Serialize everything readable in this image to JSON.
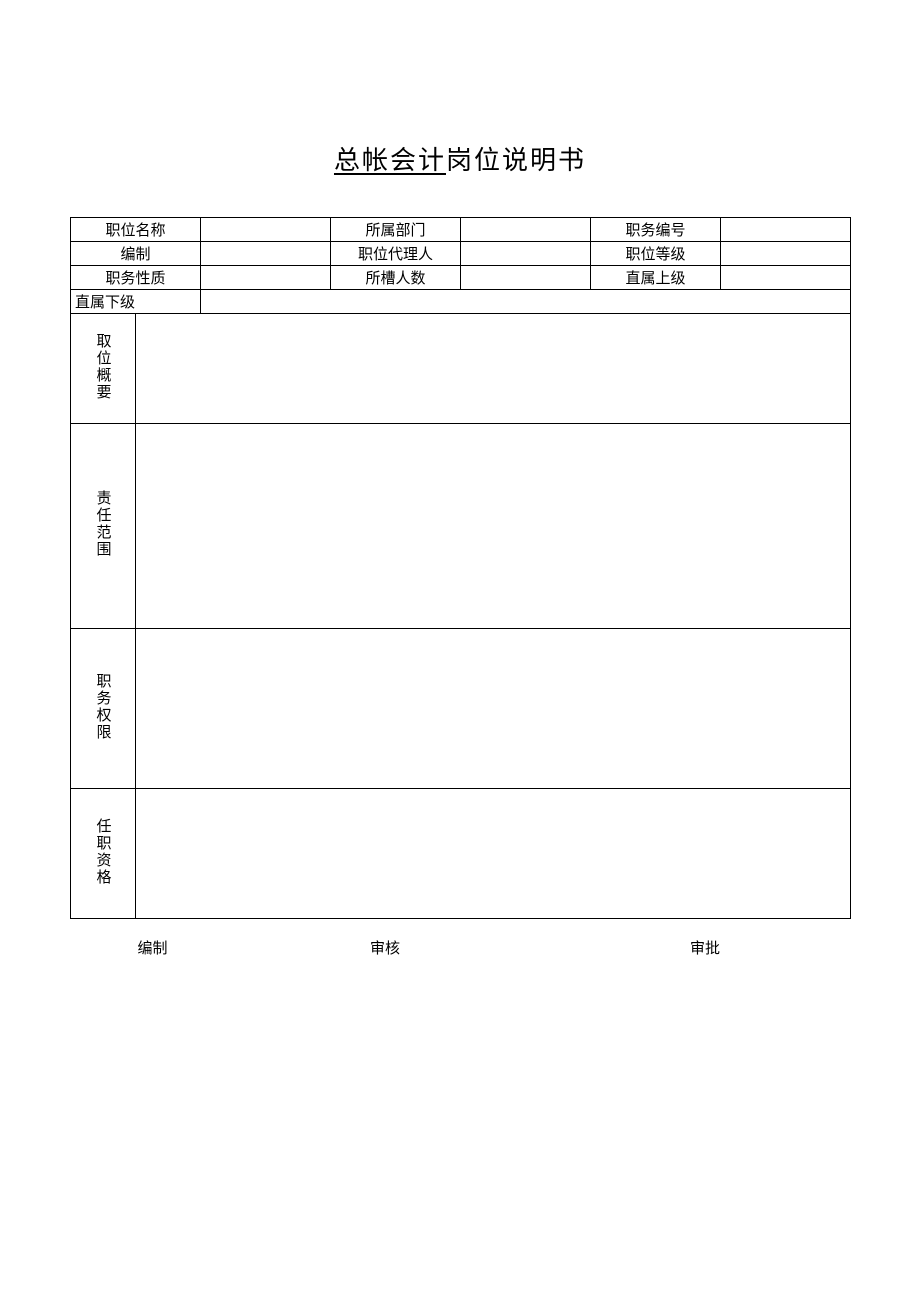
{
  "title_underlined": "总帐会计",
  "title_rest": "岗位说明书",
  "header_rows": [
    {
      "l1": "职位名称",
      "v1": "",
      "l2": "所属部门",
      "v2": "",
      "l3": "职务编号",
      "v3": ""
    },
    {
      "l1": "编制",
      "v1": "",
      "l2": "职位代理人",
      "v2": "",
      "l3": "职位等级",
      "v3": ""
    },
    {
      "l1": "职务性质",
      "v1": "",
      "l2": "所槽人数",
      "v2": "",
      "l3": "直属上级",
      "v3": ""
    }
  ],
  "direct_sub_label": "直属下级",
  "direct_sub_value": "",
  "sections": {
    "summary": {
      "label": "取位概要",
      "value": ""
    },
    "scope": {
      "label": "责任范围",
      "value": ""
    },
    "authority": {
      "label": "职务权限",
      "value": ""
    },
    "qualification": {
      "label": "任职资格",
      "value": ""
    }
  },
  "footer": {
    "prepared": "编制",
    "reviewed": "审核",
    "approved": "审批"
  }
}
